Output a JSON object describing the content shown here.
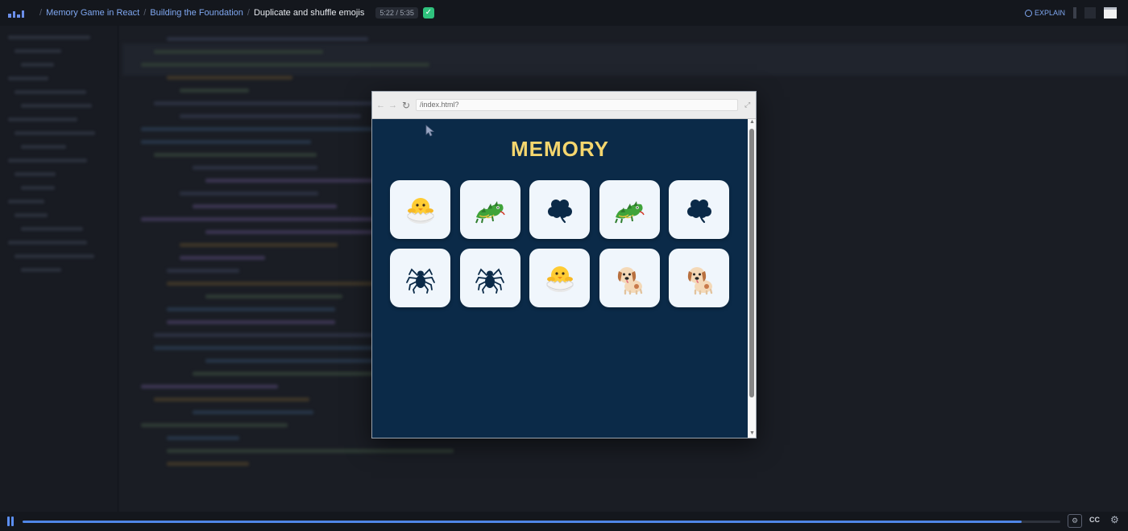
{
  "header": {
    "breadcrumbs": [
      "Memory Game in React",
      "Building the Foundation",
      "Duplicate and shuffle emojis"
    ],
    "time": "5:22 / 5:35",
    "explain_label": "EXPLAIN"
  },
  "browser": {
    "url": "/index.html?"
  },
  "game": {
    "title": "MEMORY",
    "cards": [
      {
        "emoji": "hatching chick"
      },
      {
        "emoji": "dragon"
      },
      {
        "emoji": "shamrock"
      },
      {
        "emoji": "dragon"
      },
      {
        "emoji": "shamrock"
      },
      {
        "emoji": "spider"
      },
      {
        "emoji": "spider"
      },
      {
        "emoji": "hatching chick"
      },
      {
        "emoji": "dog"
      },
      {
        "emoji": "dog"
      }
    ]
  },
  "player": {
    "progress": 0.963,
    "cc_label": "CC"
  },
  "colors": {
    "background": "#15181f",
    "game_bg": "#0b2a48",
    "title": "#f5d66e",
    "card": "#f0f6fc",
    "accent": "#4f86e8"
  }
}
